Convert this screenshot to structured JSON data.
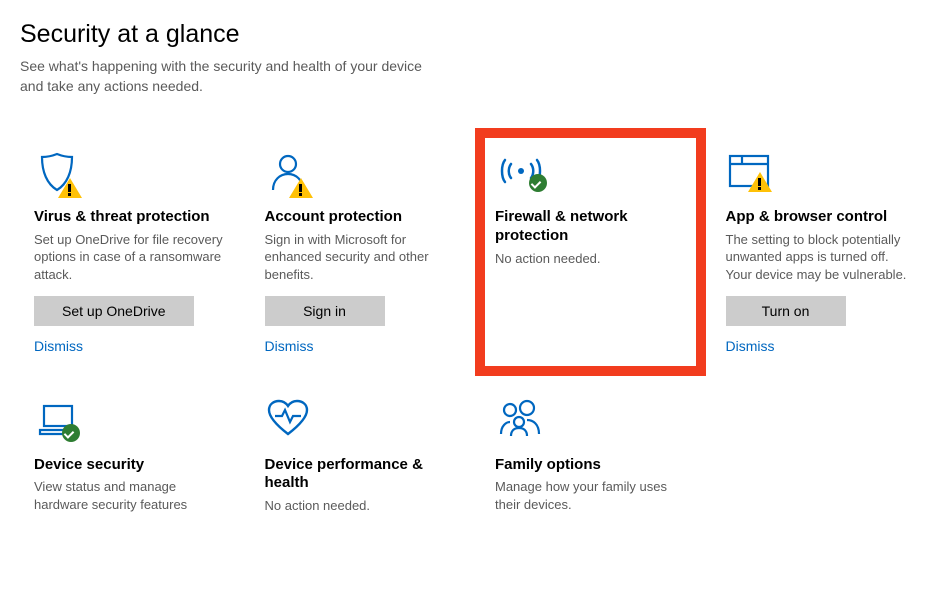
{
  "header": {
    "title": "Security at a glance",
    "subtitle": "See what's happening with the security and health of your device and take any actions needed."
  },
  "tiles": {
    "virus": {
      "title": "Virus & threat protection",
      "desc": "Set up OneDrive for file recovery options in case of a ransomware attack.",
      "button": "Set up OneDrive",
      "dismiss": "Dismiss"
    },
    "account": {
      "title": "Account protection",
      "desc": "Sign in with Microsoft for enhanced security and other benefits.",
      "button": "Sign in",
      "dismiss": "Dismiss"
    },
    "firewall": {
      "title": "Firewall & network protection",
      "desc": "No action needed."
    },
    "app": {
      "title": "App & browser control",
      "desc": "The setting to block potentially unwanted apps is turned off. Your device may be vulnerable.",
      "button": "Turn on",
      "dismiss": "Dismiss"
    },
    "device": {
      "title": "Device security",
      "desc": "View status and manage hardware security features"
    },
    "perf": {
      "title": "Device performance & health",
      "desc": "No action needed."
    },
    "family": {
      "title": "Family options",
      "desc": "Manage how your family uses their devices."
    }
  }
}
